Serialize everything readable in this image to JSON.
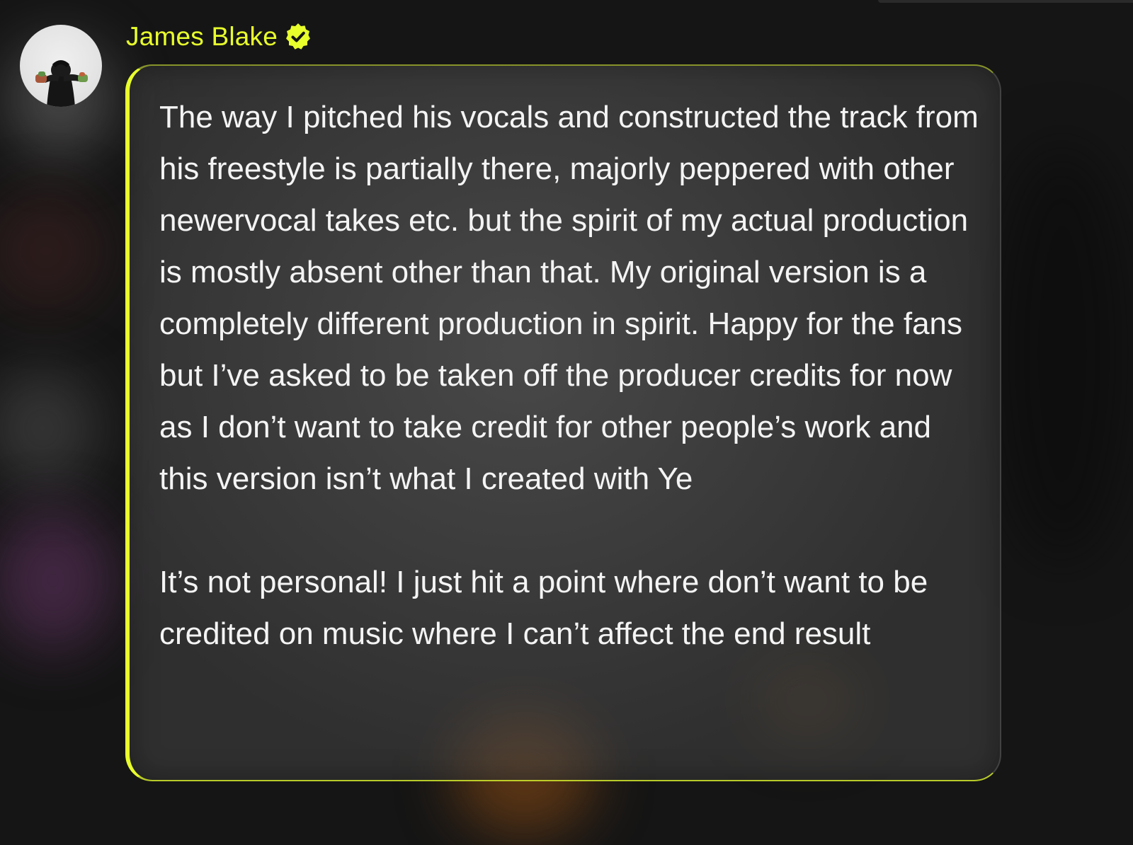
{
  "author": {
    "name": "James Blake",
    "verified": true,
    "badge_icon": "verified-badge-icon",
    "accent_color": "#e8ff2c"
  },
  "avatar": {
    "icon": "profile-photo"
  },
  "message": {
    "paragraph_1": "The way I pitched his vocals and constructed the track from his freestyle is partially there, majorly peppered with other newervocal takes etc. but the spirit of my actual production is mostly absent other than that. My original version is a completely different production in spirit. Happy for the fans but I’ve asked to be taken off the producer credits for now as I don’t want to take credit for other people’s work and this version isn’t what I created with Ye",
    "paragraph_2": "It’s not personal! I just hit a point where don’t want to be credited on music where I can’t affect the end result"
  }
}
